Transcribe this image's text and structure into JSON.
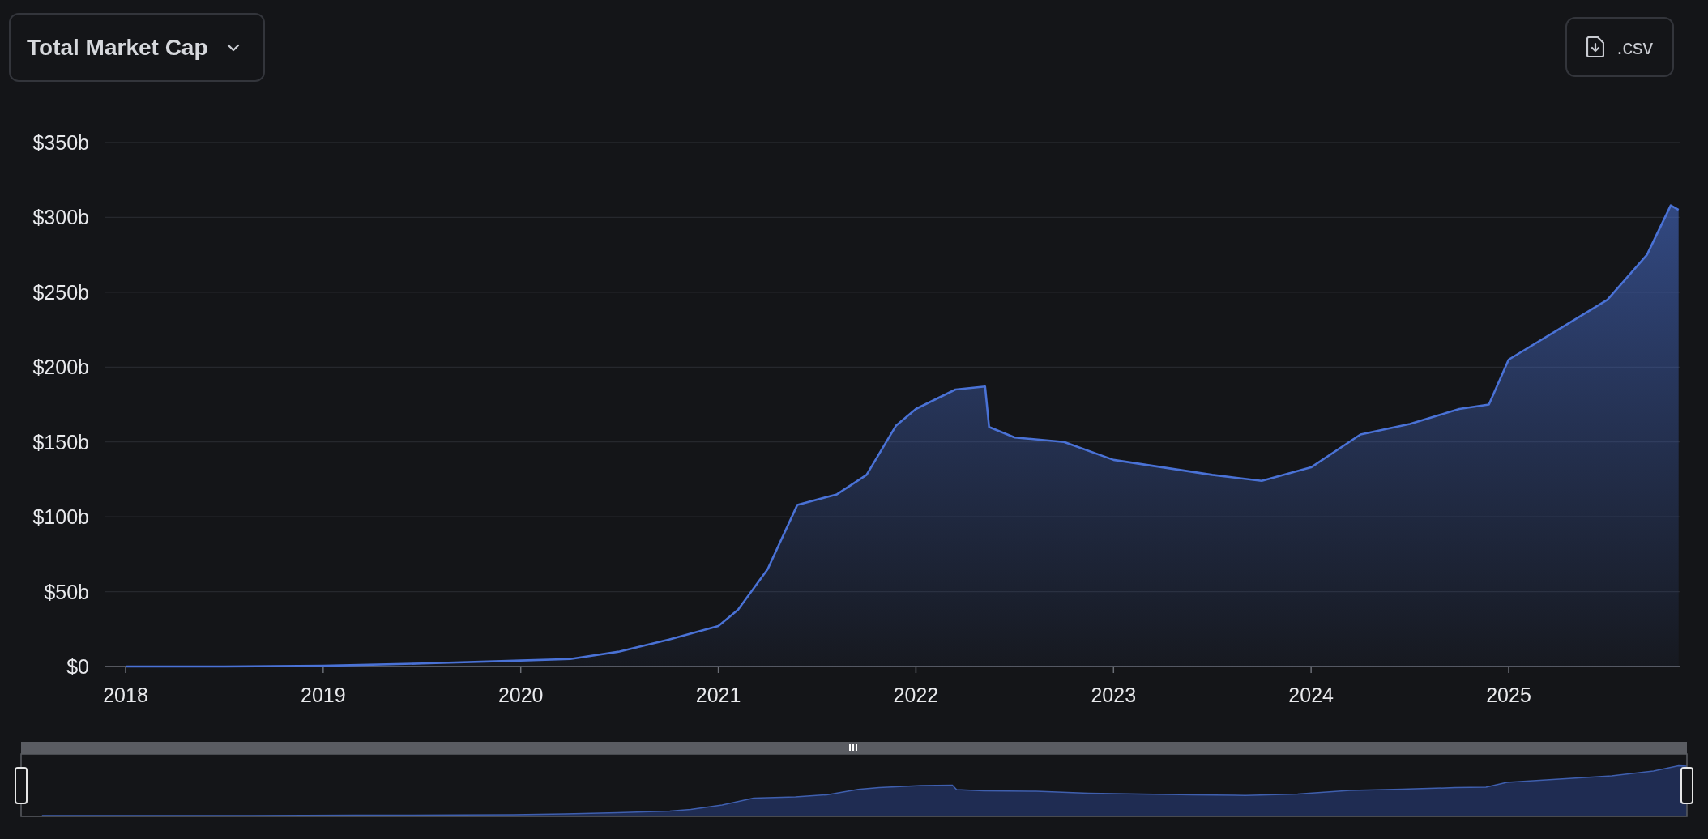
{
  "header": {
    "metric_dropdown": {
      "label": "Total Market Cap"
    },
    "download_button": {
      "label": ".csv"
    }
  },
  "chart": {
    "chart_data": {
      "type": "area",
      "grid": true,
      "x": [
        2018.0,
        2018.5,
        2019.0,
        2019.5,
        2020.0,
        2020.25,
        2020.5,
        2020.75,
        2021.0,
        2021.1,
        2021.25,
        2021.4,
        2021.6,
        2021.75,
        2021.9,
        2022.0,
        2022.2,
        2022.35,
        2022.37,
        2022.5,
        2022.75,
        2023.0,
        2023.25,
        2023.5,
        2023.75,
        2024.0,
        2024.25,
        2024.5,
        2024.75,
        2024.9,
        2025.0,
        2025.25,
        2025.5,
        2025.7,
        2025.82,
        2025.86
      ],
      "series": [
        {
          "color": "#4a72d6",
          "values": [
            0,
            0,
            0.5,
            2,
            4,
            5,
            10,
            18,
            27,
            38,
            65,
            108,
            115,
            128,
            161,
            172,
            185,
            187,
            160,
            153,
            150,
            138,
            133,
            128,
            124,
            133,
            155,
            162,
            172,
            175,
            205,
            225,
            245,
            275,
            308,
            305
          ]
        }
      ],
      "xlim": [
        2017.9,
        2025.86
      ],
      "ylim": [
        0,
        350
      ],
      "xticks": [
        2018,
        2019,
        2020,
        2021,
        2022,
        2023,
        2024,
        2025
      ],
      "yticks": [
        {
          "value": 0,
          "label": "$0"
        },
        {
          "value": 50,
          "label": "$50b"
        },
        {
          "value": 100,
          "label": "$100b"
        },
        {
          "value": 150,
          "label": "$150b"
        },
        {
          "value": 200,
          "label": "$200b"
        },
        {
          "value": 250,
          "label": "$250b"
        },
        {
          "value": 300,
          "label": "$300b"
        },
        {
          "value": 350,
          "label": "$350b"
        }
      ]
    }
  }
}
